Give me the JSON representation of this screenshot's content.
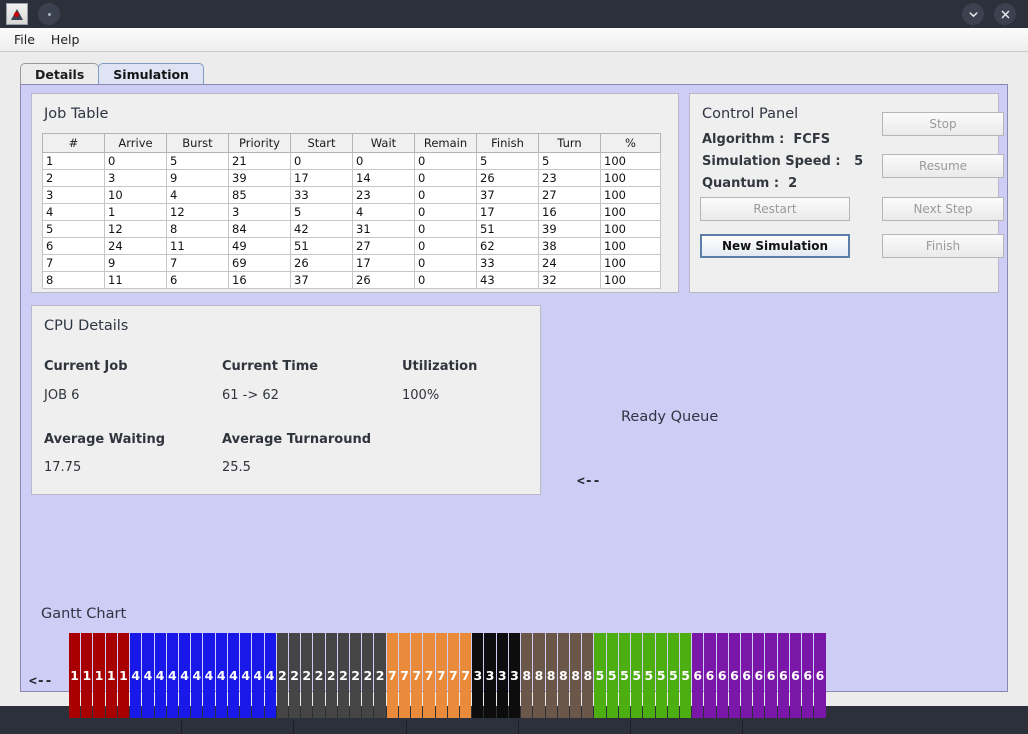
{
  "titlebar": {
    "app_icon": "java-duke-icon",
    "minimize_label": "⌄",
    "close_label": "✕"
  },
  "menubar": {
    "items": [
      {
        "label": "File"
      },
      {
        "label": "Help"
      }
    ]
  },
  "tabs": [
    {
      "label": "Details",
      "selected": false
    },
    {
      "label": "Simulation",
      "selected": true
    }
  ],
  "job_table": {
    "title": "Job Table",
    "columns": [
      "#",
      "Arrive",
      "Burst",
      "Priority",
      "Start",
      "Wait",
      "Remain",
      "Finish",
      "Turn",
      "%"
    ],
    "rows": [
      [
        "1",
        "0",
        "5",
        "21",
        "0",
        "0",
        "0",
        "5",
        "5",
        "100"
      ],
      [
        "2",
        "3",
        "9",
        "39",
        "17",
        "14",
        "0",
        "26",
        "23",
        "100"
      ],
      [
        "3",
        "10",
        "4",
        "85",
        "33",
        "23",
        "0",
        "37",
        "27",
        "100"
      ],
      [
        "4",
        "1",
        "12",
        "3",
        "5",
        "4",
        "0",
        "17",
        "16",
        "100"
      ],
      [
        "5",
        "12",
        "8",
        "84",
        "42",
        "31",
        "0",
        "51",
        "39",
        "100"
      ],
      [
        "6",
        "24",
        "11",
        "49",
        "51",
        "27",
        "0",
        "62",
        "38",
        "100"
      ],
      [
        "7",
        "9",
        "7",
        "69",
        "26",
        "17",
        "0",
        "33",
        "24",
        "100"
      ],
      [
        "8",
        "11",
        "6",
        "16",
        "37",
        "26",
        "0",
        "43",
        "32",
        "100"
      ]
    ]
  },
  "control_panel": {
    "title": "Control Panel",
    "algorithm_label": "Algorithm :  FCFS",
    "speed_label": "Simulation Speed :   5",
    "quantum_label": "Quantum :  2",
    "buttons": {
      "stop": "Stop",
      "resume": "Resume",
      "restart": "Restart",
      "next_step": "Next Step",
      "new_simulation": "New Simulation",
      "finish": "Finish"
    }
  },
  "cpu_details": {
    "title": "CPU Details",
    "current_job_label": "Current Job",
    "current_job_value": "JOB 6",
    "current_time_label": "Current Time",
    "current_time_value": "61 -> 62",
    "utilization_label": "Utilization",
    "utilization_value": "100%",
    "avg_waiting_label": "Average Waiting",
    "avg_waiting_value": "17.75",
    "avg_turnaround_label": "Average Turnaround",
    "avg_turnaround_value": "25.5"
  },
  "ready_queue": {
    "title": "Ready Queue",
    "marker": "<--",
    "items": []
  },
  "gantt": {
    "title": "Gantt Chart",
    "marker": "<--",
    "tick_interval": 10,
    "total_units": 62,
    "job_colors": {
      "1": "#a80000",
      "2": "#454545",
      "3": "#0d0d0d",
      "4": "#1818e8",
      "5": "#4cae10",
      "6": "#7a17a8",
      "7": "#ea8b3c",
      "8": "#6b564a"
    },
    "segments": [
      {
        "job": "1",
        "count": 5,
        "color": "#a80000"
      },
      {
        "job": "4",
        "count": 12,
        "color": "#1818e8"
      },
      {
        "job": "2",
        "count": 9,
        "color": "#454545"
      },
      {
        "job": "7",
        "count": 7,
        "color": "#ea8b3c"
      },
      {
        "job": "3",
        "count": 4,
        "color": "#0d0d0d"
      },
      {
        "job": "8",
        "count": 6,
        "color": "#6b564a"
      },
      {
        "job": "5",
        "count": 8,
        "color": "#4cae10"
      },
      {
        "job": "6",
        "count": 11,
        "color": "#7a17a8"
      }
    ]
  }
}
